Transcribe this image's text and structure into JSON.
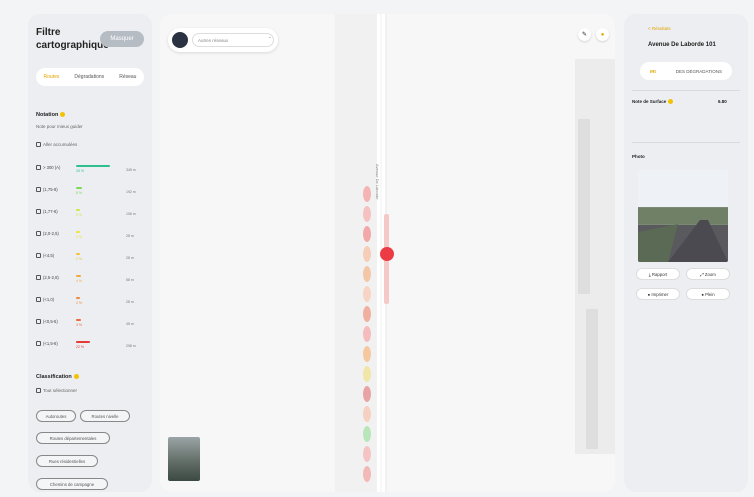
{
  "filters": {
    "title": "Filtre cartographique",
    "hide_label": "Masquer",
    "tabs": [
      "Routes",
      "Dégradations",
      "Réseau"
    ],
    "notation": {
      "heading": "Notation",
      "subheading": "Note pour mieux guider",
      "all_label": "Aller accumulées",
      "rows": [
        {
          "label": "> 300 (A)",
          "pct": "25 %",
          "count": "345 m",
          "color": "#2fbf8f"
        },
        {
          "label": "(1,75-8)",
          "pct": "8 %",
          "count": "192 m",
          "color": "#7ed957"
        },
        {
          "label": "(1,77-6)",
          "pct": "3 %",
          "count": "106 m",
          "color": "#c9e84a"
        },
        {
          "label": "(2,0-2,5)",
          "pct": "2 %",
          "count": "28 m",
          "color": "#f2e33a"
        },
        {
          "label": "(<4,5)",
          "pct": "2 %",
          "count": "28 m",
          "color": "#f2c234"
        },
        {
          "label": "(2,5-2,8)",
          "pct": "4 %",
          "count": "58 m",
          "color": "#f4a83a"
        },
        {
          "label": "(<1,0)",
          "pct": "2 %",
          "count": "28 m",
          "color": "#f08a3c"
        },
        {
          "label": "(<0,5-5)",
          "pct": "3 %",
          "count": "45 m",
          "color": "#ec6a3d"
        },
        {
          "label": "(<1,5-6)",
          "pct": "22 %",
          "count": "298 m",
          "color": "#e53935"
        }
      ]
    },
    "classification": {
      "heading": "Classification",
      "all_label": "Tout sélectionner",
      "pills": [
        "Autoroutes",
        "Routes nivelle",
        "Routes départementales",
        "Rues résidentielles",
        "Chemins de campagne"
      ]
    }
  },
  "map": {
    "search_placeholder": "Autres réseaux",
    "street_label": "Avenue De Laborde"
  },
  "details": {
    "back_label": "< Résultats",
    "title": "Avenue De Laborde 101",
    "tabs": [
      "IRI",
      "DES DÉGRADATIONS"
    ],
    "note_label": "Note de Surface",
    "note_value": "6.80",
    "photo_heading": "Photo",
    "buttons": [
      "Rapport",
      "Zoom",
      "Imprimer",
      "Plein"
    ]
  }
}
